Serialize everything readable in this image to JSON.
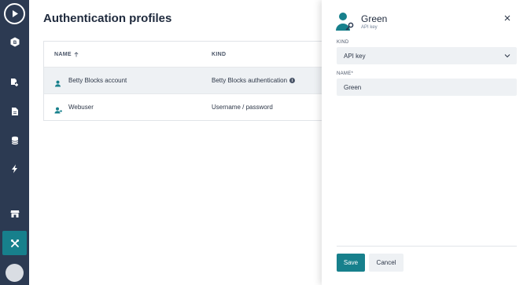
{
  "page": {
    "title": "Authentication profiles"
  },
  "table": {
    "columns": {
      "name": "NAME",
      "kind": "KIND"
    },
    "rows": [
      {
        "name": "Betty Blocks account",
        "kind": "Betty Blocks authentication",
        "icon": "user-icon",
        "has_info": true
      },
      {
        "name": "Webuser",
        "kind": "Username / password",
        "icon": "user-arrow-icon",
        "has_info": false
      }
    ]
  },
  "panel": {
    "title": "Green",
    "subtitle": "API key",
    "kind_label": "KIND",
    "kind_value": "API key",
    "name_label": "NAME*",
    "name_value": "Green",
    "save_label": "Save",
    "cancel_label": "Cancel"
  },
  "sidebar": {
    "items": [
      {
        "icon": "play-icon"
      },
      {
        "icon": "app-badge-icon"
      },
      {
        "icon": "page-add-icon"
      },
      {
        "icon": "file-icon"
      },
      {
        "icon": "database-icon"
      },
      {
        "icon": "lightning-icon"
      },
      {
        "icon": "store-icon"
      },
      {
        "icon": "tools-icon",
        "active": true
      }
    ]
  },
  "colors": {
    "sidebar": "#2c3a52",
    "accent": "#17808c",
    "row_highlight": "#eef1f4"
  }
}
